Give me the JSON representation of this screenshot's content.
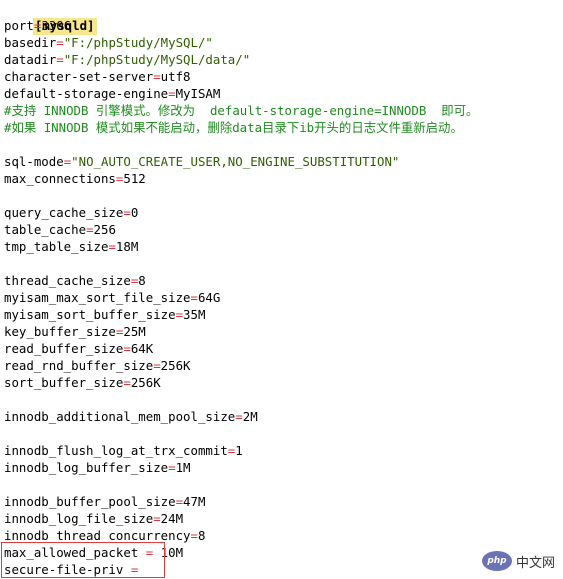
{
  "section": "[mysqld]",
  "lines": [
    {
      "t": "kv",
      "key": "port",
      "val": "3306"
    },
    {
      "t": "kv",
      "key": "basedir",
      "val": "\"F:/phpStudy/MySQL/\""
    },
    {
      "t": "kv",
      "key": "datadir",
      "val": "\"F:/phpStudy/MySQL/data/\""
    },
    {
      "t": "kv",
      "key": "character-set-server",
      "val": "utf8"
    },
    {
      "t": "kv",
      "key": "default-storage-engine",
      "val": "MyISAM"
    },
    {
      "t": "cmt",
      "text": "#支持 INNODB 引擎模式。修改为  default-storage-engine=INNODB  即可。"
    },
    {
      "t": "cmt",
      "text": "#如果 INNODB 模式如果不能启动，删除data目录下ib开头的日志文件重新启动。"
    },
    {
      "t": "blank"
    },
    {
      "t": "kv",
      "key": "sql-mode",
      "val": "\"NO_AUTO_CREATE_USER,NO_ENGINE_SUBSTITUTION\""
    },
    {
      "t": "kv",
      "key": "max_connections",
      "val": "512"
    },
    {
      "t": "blank"
    },
    {
      "t": "kv",
      "key": "query_cache_size",
      "val": "0"
    },
    {
      "t": "kv",
      "key": "table_cache",
      "val": "256"
    },
    {
      "t": "kv",
      "key": "tmp_table_size",
      "val": "18M"
    },
    {
      "t": "blank"
    },
    {
      "t": "kv",
      "key": "thread_cache_size",
      "val": "8"
    },
    {
      "t": "kv",
      "key": "myisam_max_sort_file_size",
      "val": "64G"
    },
    {
      "t": "kv",
      "key": "myisam_sort_buffer_size",
      "val": "35M"
    },
    {
      "t": "kv",
      "key": "key_buffer_size",
      "val": "25M"
    },
    {
      "t": "kv",
      "key": "read_buffer_size",
      "val": "64K"
    },
    {
      "t": "kv",
      "key": "read_rnd_buffer_size",
      "val": "256K"
    },
    {
      "t": "kv",
      "key": "sort_buffer_size",
      "val": "256K"
    },
    {
      "t": "blank"
    },
    {
      "t": "kv",
      "key": "innodb_additional_mem_pool_size",
      "val": "2M"
    },
    {
      "t": "blank"
    },
    {
      "t": "kv",
      "key": "innodb_flush_log_at_trx_commit",
      "val": "1"
    },
    {
      "t": "kv",
      "key": "innodb_log_buffer_size",
      "val": "1M"
    },
    {
      "t": "blank"
    },
    {
      "t": "kv",
      "key": "innodb_buffer_pool_size",
      "val": "47M"
    },
    {
      "t": "kv",
      "key": "innodb_log_file_size",
      "val": "24M"
    },
    {
      "t": "kv",
      "key": "innodb_thread_concurrency",
      "val": "8"
    },
    {
      "t": "kv",
      "key": "max_allowed_packet",
      "val": "10M",
      "sp": true
    },
    {
      "t": "kv",
      "key": "secure-file-priv",
      "val": "",
      "sp": true
    }
  ],
  "watermark": {
    "logo": "php",
    "text": "中文网"
  },
  "colors": {
    "operator": "#d9363e",
    "comment": "#1f8c1f",
    "section_bg": "#f6e78f",
    "highlight_box": "#e23b3b"
  }
}
